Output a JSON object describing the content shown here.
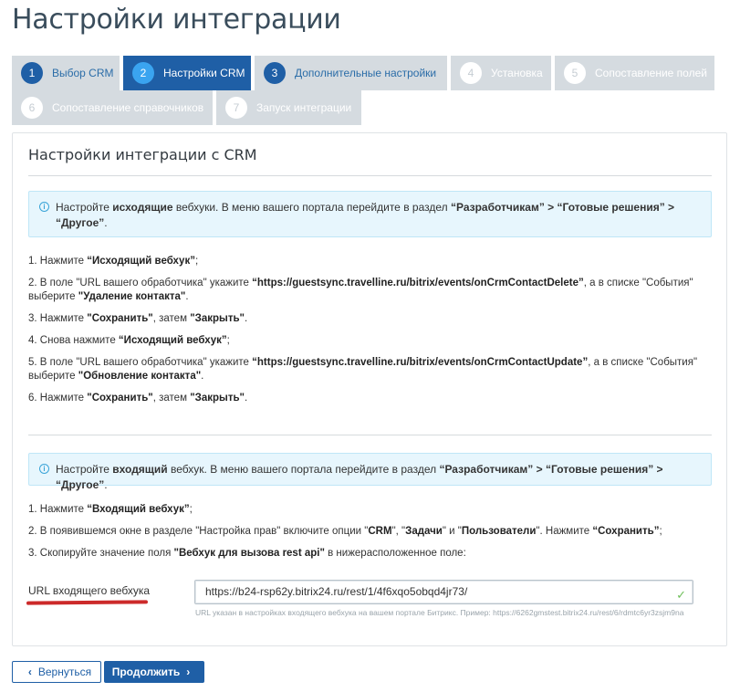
{
  "page": {
    "title": "Настройки интеграции"
  },
  "steps": [
    {
      "num": "1",
      "label": "Выбор CRM",
      "state": "done"
    },
    {
      "num": "2",
      "label": "Настройки CRM",
      "state": "active"
    },
    {
      "num": "3",
      "label": "Дополнительные настройки",
      "state": "done"
    },
    {
      "num": "4",
      "label": "Установка",
      "state": "pending"
    },
    {
      "num": "5",
      "label": "Сопоставление полей",
      "state": "pending"
    },
    {
      "num": "6",
      "label": "Сопоставление справочников",
      "state": "pending"
    },
    {
      "num": "7",
      "label": "Запуск интеграции",
      "state": "pending"
    }
  ],
  "panel": {
    "title": "Настройки интеграции с CRM",
    "outgoing_info": {
      "t1": "Настройте ",
      "b1": "исходящие",
      "t2": " вебхуки. В меню вашего портала перейдите в раздел ",
      "b2": "“Разработчикам” > “Готовые решения” > “Другое”",
      "t3": "."
    },
    "outgoing_steps": {
      "s1_t": "1. Нажмите ",
      "s1_b": "“Исходящий вебхук”",
      "s1_e": ";",
      "s2_t": "2. В поле \"URL вашего обработчика\" укажите ",
      "s2_b": "“https://guestsync.travelline.ru/bitrix/events/onCrmContactDelete”",
      "s2_t2": ", а в списке \"События\" выберите ",
      "s2_b2": "\"Удаление контакта\"",
      "s2_e": ".",
      "s3_t": "3. Нажмите ",
      "s3_b": "\"Сохранить\"",
      "s3_t2": ", затем ",
      "s3_b2": "\"Закрыть\"",
      "s3_e": ".",
      "s4_t": "4. Снова нажмите ",
      "s4_b": "“Исходящий вебхук”",
      "s4_e": ";",
      "s5_t": "5. В поле \"URL вашего обработчика\" укажите ",
      "s5_b": "“https://guestsync.travelline.ru/bitrix/events/onCrmContactUpdate”",
      "s5_t2": ", а в списке \"События\" выберите ",
      "s5_b2": "\"Обновление контакта\"",
      "s5_e": ".",
      "s6_t": "6. Нажмите ",
      "s6_b": "\"Сохранить\"",
      "s6_t2": ", затем ",
      "s6_b2": "\"Закрыть\"",
      "s6_e": "."
    },
    "incoming_info": {
      "t1": "Настройте ",
      "b1": "входящий",
      "t2": " вебхук. В меню вашего портала перейдите в раздел ",
      "b2": "“Разработчикам” > “Готовые решения” > “Другое”",
      "t3": "."
    },
    "incoming_steps": {
      "s1_t": "1. Нажмите ",
      "s1_b": "“Входящий вебхук”",
      "s1_e": ";",
      "s2_t": "2. В появившемся окне в разделе \"Настройка прав\" включите опции \"",
      "s2_b1": "CRM",
      "s2_m1": "\", \"",
      "s2_b2": "Задачи",
      "s2_m2": "\" и \"",
      "s2_b3": "Пользователи",
      "s2_m3": "\". Нажмите ",
      "s2_b4": "“Сохранить”",
      "s2_e": ";",
      "s3_t": "3. Скопируйте значение поля ",
      "s3_b": "\"Вебхук для вызова rest api\"",
      "s3_e": " в нижерасположенное поле:"
    },
    "url_field": {
      "label": "URL входящего вебхука",
      "value": "https://b24-rsp62y.bitrix24.ru/rest/1/4f6xqo5obqd4jr73/",
      "hint": "URL указан в настройках входящего вебхука на вашем портале Битрикс. Пример: https://6262gmstest.bitrix24.ru/rest/6/rdmtc6yr3zsjm9na"
    }
  },
  "buttons": {
    "back": "Вернуться",
    "next": "Продолжить"
  },
  "colors": {
    "primary": "#1f5fa6",
    "active_badge": "#3aa4f0",
    "step_bg": "#d5dbe0",
    "info_bg": "#e7f6fd",
    "underline": "#cc2a2a",
    "check": "#6fbf5a"
  }
}
